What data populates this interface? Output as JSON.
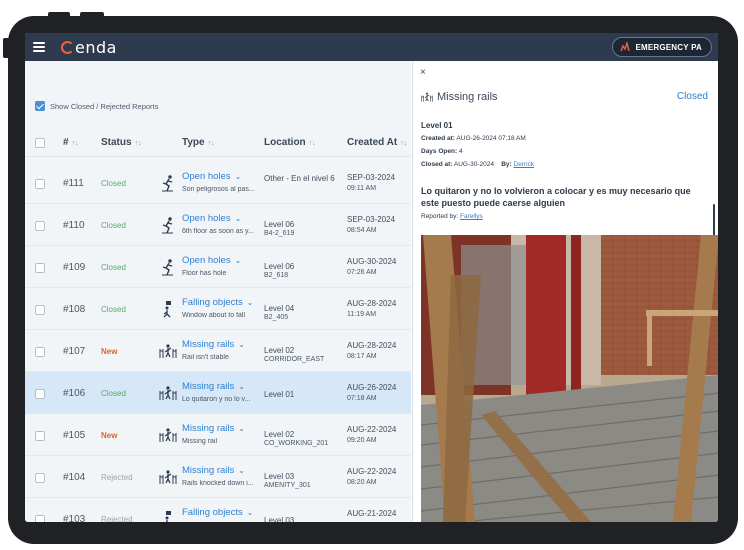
{
  "app": {
    "logo_text": "enda",
    "emergency_label": "EMERGENCY PA",
    "accent_color": "#2f7fd0",
    "topbar_color": "#2e3a4d"
  },
  "filter": {
    "show_closed_label": "Show Closed / Rejected Reports",
    "checked": true
  },
  "table": {
    "headers": {
      "id": "#",
      "status": "Status",
      "type": "Type",
      "location": "Location",
      "created": "Created At"
    },
    "rows": [
      {
        "id": "#111",
        "status": "Closed",
        "status_kind": "closed",
        "icon": "person-falling-icon",
        "type": "Open holes",
        "desc": "Son peligrosos al pas...",
        "loc1": "Other - En el nivel 6",
        "loc2": "",
        "date": "SEP-03-2024",
        "time": "09:11 AM"
      },
      {
        "id": "#110",
        "status": "Closed",
        "status_kind": "closed",
        "icon": "person-falling-icon",
        "type": "Open holes",
        "desc": "6th floor as soon as y...",
        "loc1": "Level 06",
        "loc2": "B4-2_619",
        "date": "SEP-03-2024",
        "time": "08:54 AM"
      },
      {
        "id": "#109",
        "status": "Closed",
        "status_kind": "closed",
        "icon": "person-falling-icon",
        "type": "Open holes",
        "desc": "Floor has hole",
        "loc1": "Level 06",
        "loc2": "B2_618",
        "date": "AUG-30-2024",
        "time": "07:26 AM"
      },
      {
        "id": "#108",
        "status": "Closed",
        "status_kind": "closed",
        "icon": "falling-object-icon",
        "type": "Falling objects",
        "desc": "Window about to fall",
        "loc1": "Level 04",
        "loc2": "B2_405",
        "date": "AUG-28-2024",
        "time": "11:19 AM"
      },
      {
        "id": "#107",
        "status": "New",
        "status_kind": "new",
        "icon": "missing-rail-icon",
        "type": "Missing rails",
        "desc": "Rail isn't stable",
        "loc1": "Level 02",
        "loc2": "CORRIDOR_EAST",
        "date": "AUG-28-2024",
        "time": "08:17 AM"
      },
      {
        "id": "#106",
        "status": "Closed",
        "status_kind": "closed",
        "icon": "missing-rail-icon",
        "type": "Missing rails",
        "desc": "Lo quitaron y no lo v...",
        "loc1": "Level 01",
        "loc2": "",
        "date": "AUG-26-2024",
        "time": "07:18 AM",
        "selected": true
      },
      {
        "id": "#105",
        "status": "New",
        "status_kind": "new",
        "icon": "missing-rail-icon",
        "type": "Missing rails",
        "desc": "Missing rail",
        "loc1": "Level 02",
        "loc2": "CO_WORKING_201",
        "date": "AUG-22-2024",
        "time": "09:20 AM"
      },
      {
        "id": "#104",
        "status": "Rejected",
        "status_kind": "rejected",
        "icon": "missing-rail-icon",
        "type": "Missing rails",
        "desc": "Rails knocked down i...",
        "loc1": "Level 03",
        "loc2": "AMENITY_301",
        "date": "AUG-22-2024",
        "time": "08:20 AM"
      },
      {
        "id": "#103",
        "status": "Rejected",
        "status_kind": "rejected",
        "icon": "falling-object-icon",
        "type": "Falling objects",
        "desc": "",
        "loc1": "Level 03",
        "loc2": "",
        "date": "AUG-21-2024",
        "time": ""
      }
    ]
  },
  "detail": {
    "close_label": "×",
    "title": "Missing rails",
    "status": "Closed",
    "level": "Level 01",
    "created_label": "Created at:",
    "created_value": "AUG-26-2024 07:18 AM",
    "days_open_label": "Days Open:",
    "days_open_value": "4",
    "closed_label": "Closed at:",
    "closed_value": "AUG-30-2024",
    "by_label": "By:",
    "by_value": "Derrick",
    "comment": "Lo quitaron y no lo volvieron a colocar y es muy necesario que este puesto puede caerse alguien",
    "reported_label": "Reported by:",
    "reported_value": "Farellys"
  }
}
